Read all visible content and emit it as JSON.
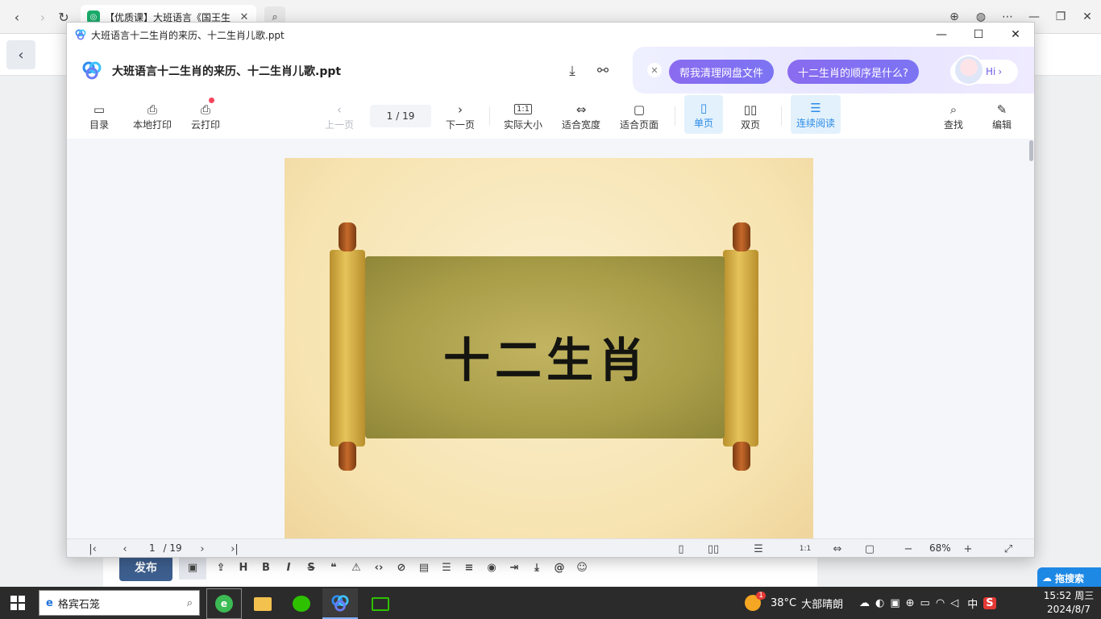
{
  "browser": {
    "tab_title": "【优质课】大班语言《国王生",
    "tab_close": "✕"
  },
  "window": {
    "title": "大班语言十二生肖的来历、十二生肖儿歌.ppt",
    "controls": {
      "minimize": "—",
      "maximize": "☐",
      "close": "✕"
    }
  },
  "header": {
    "doc_title": "大班语言十二生肖的来历、十二生肖儿歌.ppt"
  },
  "ai_bar": {
    "close_label": "✕",
    "chip1": "帮我清理网盘文件",
    "chip2": "十二生肖的顺序是什么?",
    "hi": "Hi",
    "hi_arrow": "›"
  },
  "toolbar": {
    "toc": "目录",
    "local_print": "本地打印",
    "cloud_print": "云打印",
    "prev_page": "上一页",
    "page_current": "1",
    "page_total": "/ 19",
    "next_page": "下一页",
    "actual_size": "实际大小",
    "fit_width": "适合宽度",
    "fit_page": "适合页面",
    "single_page": "单页",
    "double_page": "双页",
    "continuous": "连续阅读",
    "find": "查找",
    "edit": "编辑"
  },
  "slide": {
    "title": "十二生肖"
  },
  "bottom_bar": {
    "page_current": "1",
    "page_total": "/ 19",
    "zoom": "68%",
    "zoom_out": "−",
    "zoom_in": "+"
  },
  "page_behind": {
    "publish": "发布",
    "baidu_float": "拖搜索"
  },
  "taskbar": {
    "search_text": "格宾石笼",
    "weather_temp": "38°C",
    "weather_text": "大部晴朗",
    "weather_badge": "1",
    "ime": "中",
    "time": "15:52 周三",
    "date": "2024/8/7"
  },
  "colors": {
    "accent_blue": "#2a8be8",
    "ai_purple": "#7c74f3",
    "publish_blue": "#3d5f8f",
    "taskbar": "#2b2b2b"
  }
}
